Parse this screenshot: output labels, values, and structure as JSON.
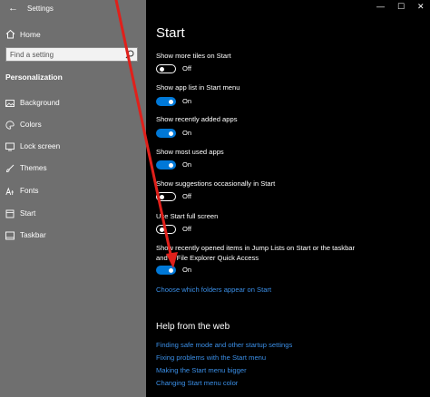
{
  "window": {
    "title": "Settings",
    "back_glyph": "←",
    "minimize_glyph": "—",
    "maximize_glyph": "☐",
    "close_glyph": "✕"
  },
  "sidebar": {
    "home_label": "Home",
    "search_placeholder": "Find a setting",
    "section": "Personalization",
    "items": [
      {
        "label": "Background",
        "icon": "image-icon"
      },
      {
        "label": "Colors",
        "icon": "palette-icon"
      },
      {
        "label": "Lock screen",
        "icon": "lock-screen-icon"
      },
      {
        "label": "Themes",
        "icon": "brush-icon"
      },
      {
        "label": "Fonts",
        "icon": "font-icon"
      },
      {
        "label": "Start",
        "icon": "start-icon"
      },
      {
        "label": "Taskbar",
        "icon": "taskbar-icon"
      }
    ]
  },
  "main": {
    "title": "Start",
    "settings": [
      {
        "label": "Show more tiles on Start",
        "state": "Off"
      },
      {
        "label": "Show app list in Start menu",
        "state": "On"
      },
      {
        "label": "Show recently added apps",
        "state": "On"
      },
      {
        "label": "Show most used apps",
        "state": "On"
      },
      {
        "label": "Show suggestions occasionally in Start",
        "state": "Off"
      },
      {
        "label": "Use Start full screen",
        "state": "Off"
      },
      {
        "label": "Show recently opened items in Jump Lists on Start or the taskbar and in File Explorer Quick Access",
        "state": "On"
      }
    ],
    "folders_link": "Choose which folders appear on Start",
    "help": {
      "title": "Help from the web",
      "links": [
        "Finding safe mode and other startup settings",
        "Fixing problems with the Start menu",
        "Making the Start menu bigger",
        "Changing Start menu color"
      ]
    }
  },
  "colors": {
    "sidebar_bg": "#6f6f6f",
    "content_bg": "#000000",
    "accent": "#0078d7",
    "link": "#3a8ee6",
    "annotation_arrow": "#e0201b"
  }
}
